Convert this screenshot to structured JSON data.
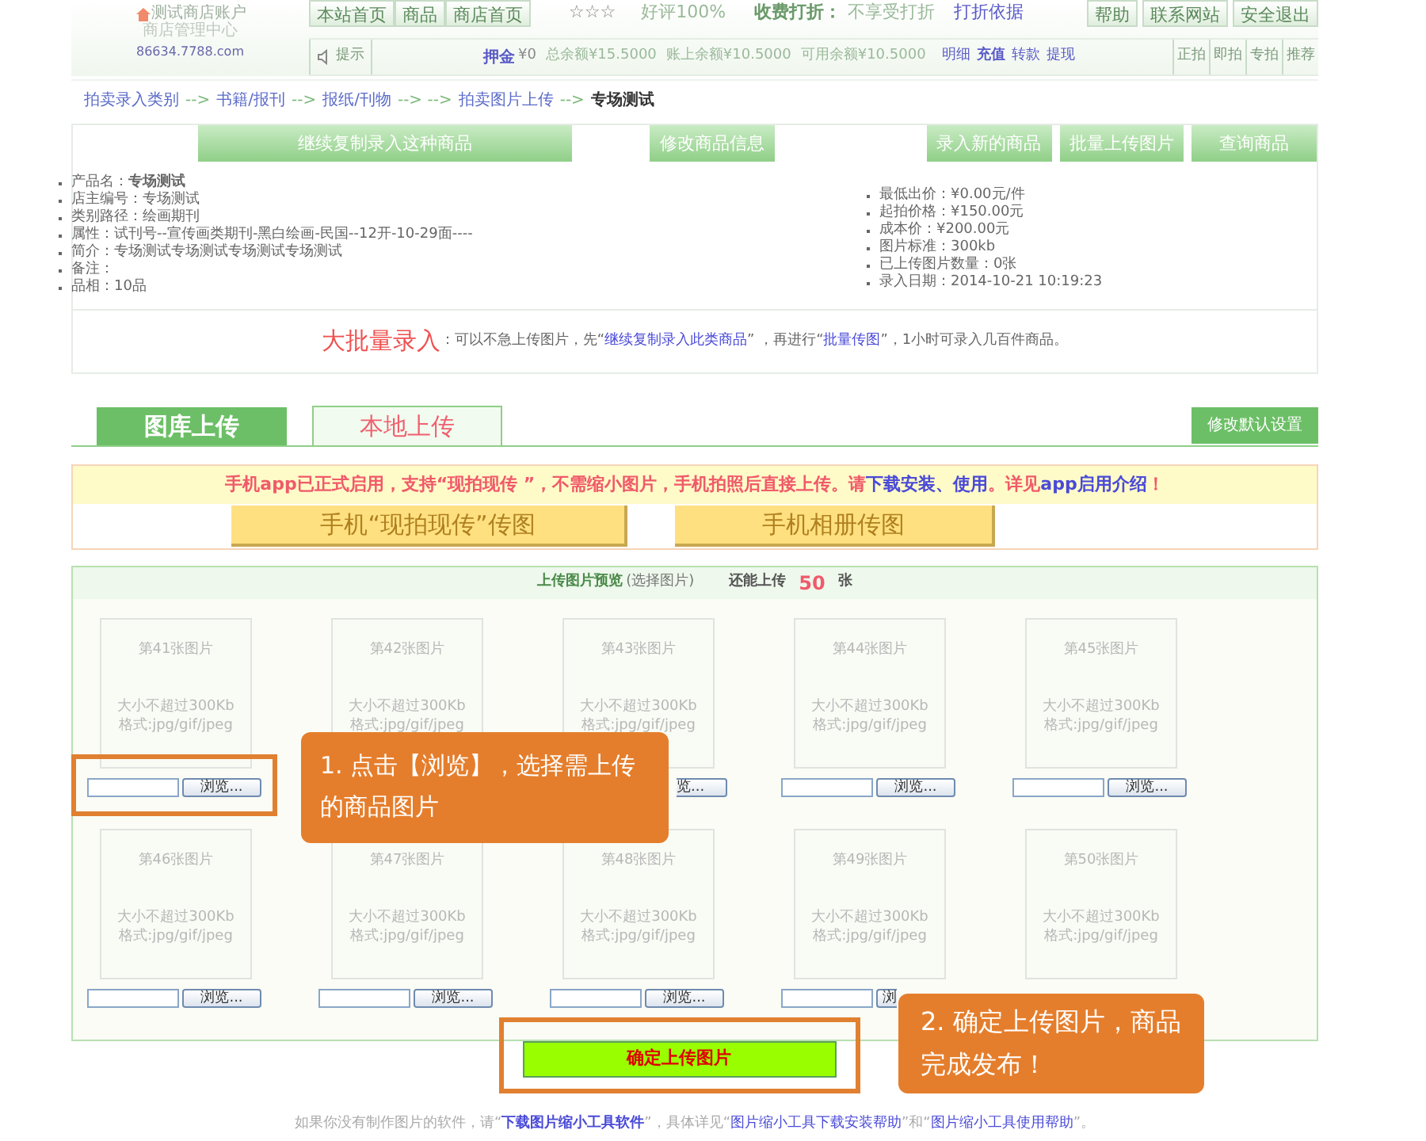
{
  "header": {
    "shop_name": "测试商店账户",
    "center": "商店管理中心",
    "domain": "86634.7788.com",
    "nav": [
      "本站首页",
      "商品",
      "商店首页"
    ],
    "stars": "☆☆☆",
    "rating": "好评100%",
    "discount_label": "收费打折：",
    "discount_value": "不享受打折",
    "discount_link": "打折依据",
    "top_links": [
      "帮助",
      "联系网站",
      "安全退出"
    ],
    "tip": "提示",
    "deposit_label": "押金",
    "deposit_value": "¥0",
    "balances": [
      "总余额¥15.5000",
      "账上余额¥10.5000",
      "可用余额¥10.5000"
    ],
    "account_links": [
      {
        "label": "明细",
        "bold": false
      },
      {
        "label": "充值",
        "bold": true
      },
      {
        "label": "转款",
        "bold": false
      },
      {
        "label": "提现",
        "bold": false
      }
    ],
    "mode_links": [
      "正拍",
      "即拍",
      "专拍",
      "推荐"
    ]
  },
  "breadcrumb": [
    {
      "label": "拍卖录入类别",
      "kind": "link"
    },
    {
      "label": "-->",
      "kind": "sep"
    },
    {
      "label": "书籍/报刊",
      "kind": "link"
    },
    {
      "label": "-->",
      "kind": "sep"
    },
    {
      "label": "报纸/刊物",
      "kind": "link"
    },
    {
      "label": "--> -->",
      "kind": "sep"
    },
    {
      "label": "拍卖图片上传",
      "kind": "link"
    },
    {
      "label": "-->",
      "kind": "sep"
    },
    {
      "label": "专场测试",
      "kind": "current"
    }
  ],
  "actions": [
    "继续复制录入这种商品",
    "修改商品信息",
    "录入新的商品",
    "批量上传图片",
    "查询商品"
  ],
  "info_left": [
    "产品名：**专场测试**",
    "店主编号：专场测试",
    "类别路径：绘画期刊",
    "属性：试刊号--宣传画类期刊-黑白绘画-民国--12开-10-29面----",
    "简介：专场测试专场测试专场测试专场测试",
    "备注：",
    "品相：10品"
  ],
  "info_right": [
    "最低出价：¥0.00元/件",
    "起拍价格：¥150.00元",
    "成本价：¥200.00元",
    "图片标准：300kb",
    "已上传图片数量：0张",
    "录入日期：2014-10-21 10:19:23"
  ],
  "bulk": {
    "title": "大批量录入",
    "segments": [
      {
        "text": "：可以不急上传图片，先“",
        "kind": "text"
      },
      {
        "text": "继续复制录入此类商品",
        "kind": "link"
      },
      {
        "text": "” ，再进行“",
        "kind": "text"
      },
      {
        "text": "批量传图",
        "kind": "link"
      },
      {
        "text": "”，1小时可录入几百件商品。",
        "kind": "text"
      }
    ]
  },
  "tabs": [
    {
      "label": "图库上传",
      "selected": false
    },
    {
      "label": "本地上传",
      "selected": true
    }
  ],
  "settings_button": "修改默认设置",
  "notice": [
    {
      "text": "手机app已正式启用，支持“现拍现传 ”，不需缩小图片，手机拍照后直接上传。请",
      "kind": "text"
    },
    {
      "text": "下载安装、使用",
      "kind": "link"
    },
    {
      "text": "。详见",
      "kind": "text"
    },
    {
      "text": "app启用介绍",
      "kind": "link"
    },
    {
      "text": "！",
      "kind": "text"
    }
  ],
  "phone_buttons": [
    "手机“现拍现传”传图",
    "手机相册传图"
  ],
  "upload": {
    "title": "上传图片预览",
    "hint": "(选择图片)",
    "remaining_label": "还能上传",
    "remaining": "50",
    "unit": "张"
  },
  "slots": [
    {
      "title": "第41张图片",
      "size": "大小不超过300Kb",
      "format": "格式:jpg/gif/jpeg",
      "browse": "浏览...",
      "kind": "full"
    },
    {
      "title": "第42张图片",
      "size": "大小不超过300Kb",
      "format": "格式:jpg/gif/jpeg",
      "kind": "covered"
    },
    {
      "title": "第43张图片",
      "size": "大小不超过300Kb",
      "format": "格式:jpg/gif/jpeg",
      "browse": "览...",
      "kind": "cutleft"
    },
    {
      "title": "第44张图片",
      "size": "大小不超过300Kb",
      "format": "格式:jpg/gif/jpeg",
      "browse": "浏览...",
      "kind": "full"
    },
    {
      "title": "第45张图片",
      "size": "大小不超过300Kb",
      "format": "格式:jpg/gif/jpeg",
      "browse": "浏览...",
      "kind": "full"
    },
    {
      "title": "第46张图片",
      "size": "大小不超过300Kb",
      "format": "格式:jpg/gif/jpeg",
      "browse": "浏览...",
      "kind": "full"
    },
    {
      "title": "第47张图片",
      "size": "大小不超过300Kb",
      "format": "格式:jpg/gif/jpeg",
      "browse": "浏览...",
      "kind": "full"
    },
    {
      "title": "第48张图片",
      "size": "大小不超过300Kb",
      "format": "格式:jpg/gif/jpeg",
      "browse": "浏览...",
      "kind": "full"
    },
    {
      "title": "第49张图片",
      "size": "大小不超过300Kb",
      "format": "格式:jpg/gif/jpeg",
      "browse": "浏",
      "kind": "cutright"
    },
    {
      "title": "第50张图片",
      "size": "大小不超过300Kb",
      "format": "格式:jpg/gif/jpeg",
      "kind": "covered"
    }
  ],
  "confirm_button": "确定上传图片",
  "callouts": [
    "1. 点击【浏览】，选择需上传的商品图片",
    "2. 确定上传图片，商品完成发布！"
  ],
  "footer": [
    {
      "text": "如果你没有制作图片的软件，请“",
      "kind": "text"
    },
    {
      "text": "下载图片缩小工具软件",
      "kind": "strong-link"
    },
    {
      "text": "”，具体详见“",
      "kind": "text"
    },
    {
      "text": "图片缩小工具下载安装帮助",
      "kind": "link"
    },
    {
      "text": "”和“",
      "kind": "text"
    },
    {
      "text": "图片缩小工具使用帮助",
      "kind": "link"
    },
    {
      "text": "”。",
      "kind": "text"
    }
  ]
}
